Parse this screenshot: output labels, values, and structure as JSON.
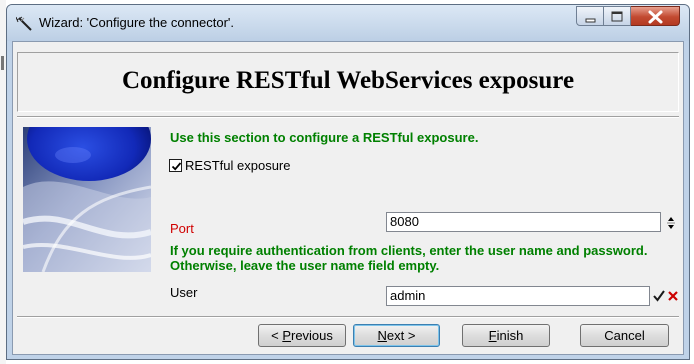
{
  "window": {
    "title": "Wizard: 'Configure the connector'."
  },
  "header": {
    "title": "Configure RESTful WebServices exposure"
  },
  "section": {
    "intro": "Use this section to configure a RESTful exposure.",
    "restful_exposure_label": "RESTful exposure",
    "restful_exposure_checked": true,
    "port_label": "Port",
    "port_value": "8080",
    "auth_hint": "If you require authentication from clients, enter the user name and password. Otherwise, leave the user name field empty.",
    "user_label": "User",
    "user_value": "admin"
  },
  "buttons": {
    "previous_mnemonic": "P",
    "previous_rest": "revious",
    "previous_prefix": "< ",
    "next_mnemonic": "N",
    "next_rest": "ext >",
    "finish_mnemonic": "F",
    "finish_rest": "inish",
    "cancel": "Cancel"
  },
  "colors": {
    "hint_text": "#008000",
    "required_label": "#d00000",
    "accept_icon": "#1a1a1a",
    "reject_icon": "#cc0000"
  },
  "icons": {
    "app": "wizard-wand-icon",
    "minimize": "minimize-icon",
    "maximize": "maximize-icon",
    "close": "close-icon",
    "spinner": "spinner-arrows-icon",
    "accept": "checkmark-icon",
    "reject": "red-x-icon"
  }
}
